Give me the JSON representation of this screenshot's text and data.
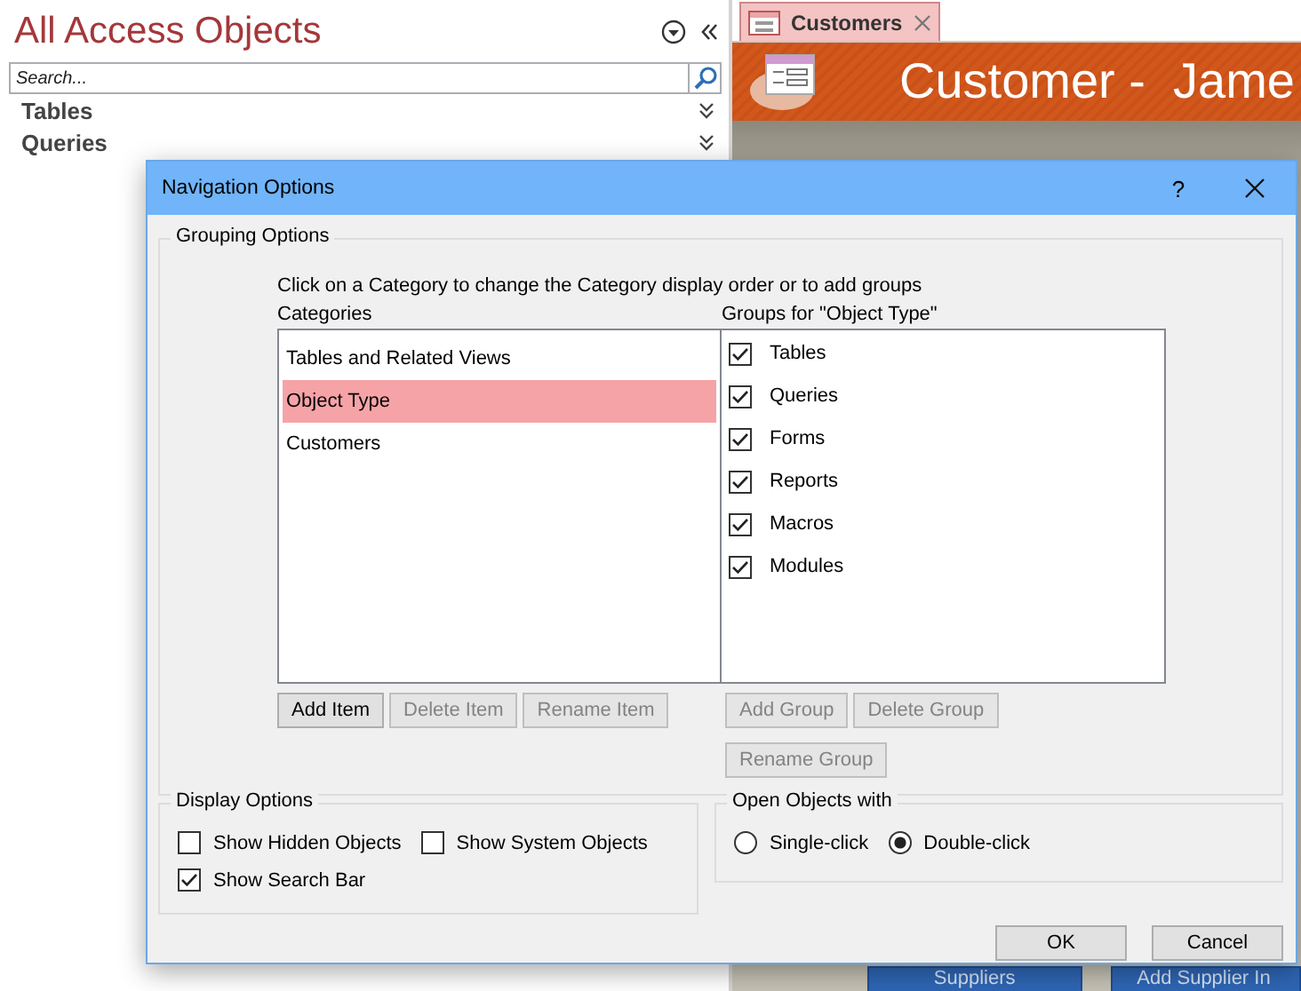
{
  "nav_pane": {
    "title": "All Access Objects",
    "search": {
      "placeholder": "Search..."
    },
    "groups": [
      {
        "label": "Tables",
        "expanded": false
      },
      {
        "label": "Queries",
        "expanded": false
      }
    ]
  },
  "document": {
    "tabs": [
      {
        "label": "Customers",
        "selected": true
      }
    ],
    "header_title": "Customer -  Jame",
    "buttons": [
      "Suppliers",
      "Add Supplier In"
    ]
  },
  "dialog": {
    "title": "Navigation Options",
    "help": "?",
    "grouping_options": {
      "legend": "Grouping Options",
      "instruction": "Click on a Category to change the Category display order or to add groups",
      "categories_label": "Categories",
      "groups_label": "Groups for \"Object Type\"",
      "categories": [
        {
          "label": "Tables and Related Views",
          "selected": false
        },
        {
          "label": "Object Type",
          "selected": true
        },
        {
          "label": "Customers",
          "selected": false
        }
      ],
      "groups": [
        {
          "label": "Tables",
          "checked": true
        },
        {
          "label": "Queries",
          "checked": true
        },
        {
          "label": "Forms",
          "checked": true
        },
        {
          "label": "Reports",
          "checked": true
        },
        {
          "label": "Macros",
          "checked": true
        },
        {
          "label": "Modules",
          "checked": true
        }
      ],
      "category_buttons": [
        {
          "label": "Add Item",
          "disabled": false
        },
        {
          "label": "Delete Item",
          "disabled": true
        },
        {
          "label": "Rename Item",
          "disabled": true
        }
      ],
      "group_buttons": [
        {
          "label": "Add Group",
          "disabled": true
        },
        {
          "label": "Delete Group",
          "disabled": true
        },
        {
          "label": "Rename Group",
          "disabled": true
        }
      ]
    },
    "display_options": {
      "legend": "Display Options",
      "options": [
        {
          "label": "Show Hidden Objects",
          "checked": false
        },
        {
          "label": "Show System Objects",
          "checked": false
        },
        {
          "label": "Show Search Bar",
          "checked": true
        }
      ]
    },
    "open_objects": {
      "legend": "Open Objects with",
      "options": [
        {
          "label": "Single-click",
          "selected": false
        },
        {
          "label": "Double-click",
          "selected": true
        }
      ]
    },
    "buttons": [
      "OK",
      "Cancel"
    ]
  }
}
